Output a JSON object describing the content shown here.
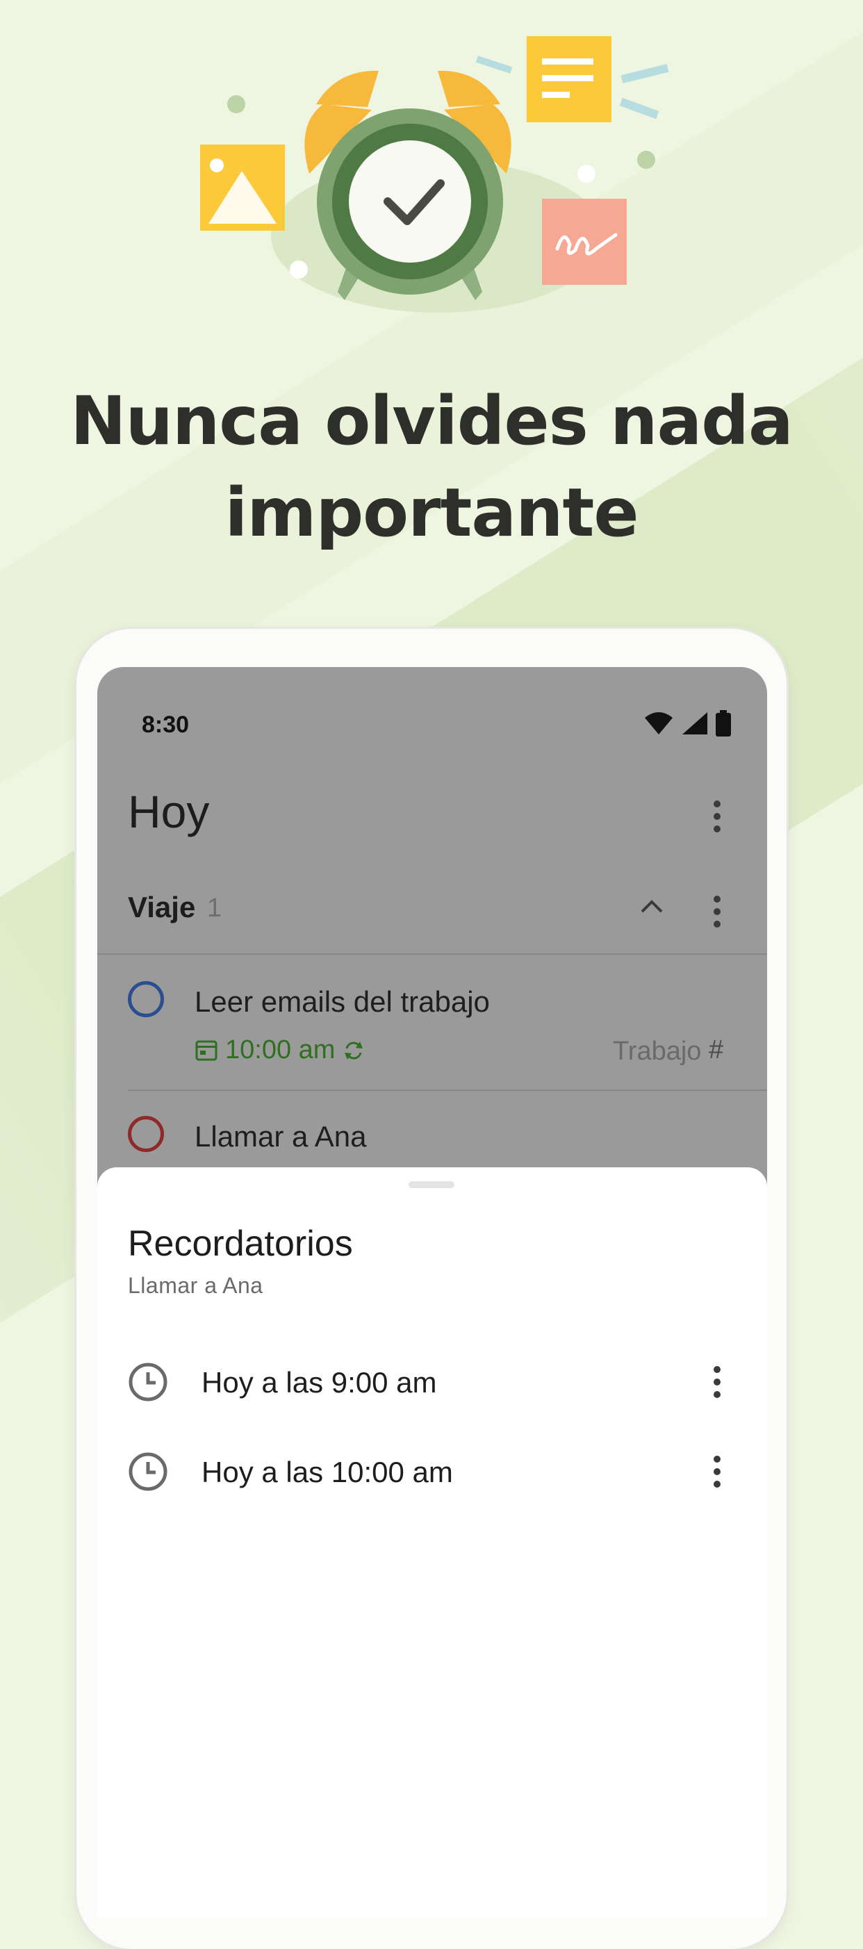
{
  "headline": {
    "line1": "Nunca olvides nada",
    "line2": "importante"
  },
  "status_bar": {
    "time": "8:30",
    "icons": [
      "wifi-icon",
      "signal-icon",
      "battery-icon"
    ]
  },
  "app": {
    "title": "Hoy"
  },
  "section": {
    "name": "Viaje",
    "count": "1"
  },
  "tasks": [
    {
      "title": "Leer emails del trabajo",
      "time": "10:00 am",
      "label": "Trabajo",
      "priority_color": "#2a4f8f"
    },
    {
      "title": "Llamar a Ana",
      "priority_color": "#8f2a2a"
    }
  ],
  "reminders_sheet": {
    "title": "Recordatorios",
    "subtitle": "Llamar a Ana",
    "items": [
      {
        "text": "Hoy a las 9:00 am"
      },
      {
        "text": "Hoy a las 10:00 am"
      }
    ]
  },
  "colors": {
    "background": "#eef5e1",
    "overlay_gray": "#9a9a9a",
    "accent_green": "#2f6f1f",
    "clock_green": "#5f8a55",
    "bell_yellow": "#f6b93b",
    "note_yellow": "#fcc93b",
    "note_pink": "#f6a894"
  }
}
